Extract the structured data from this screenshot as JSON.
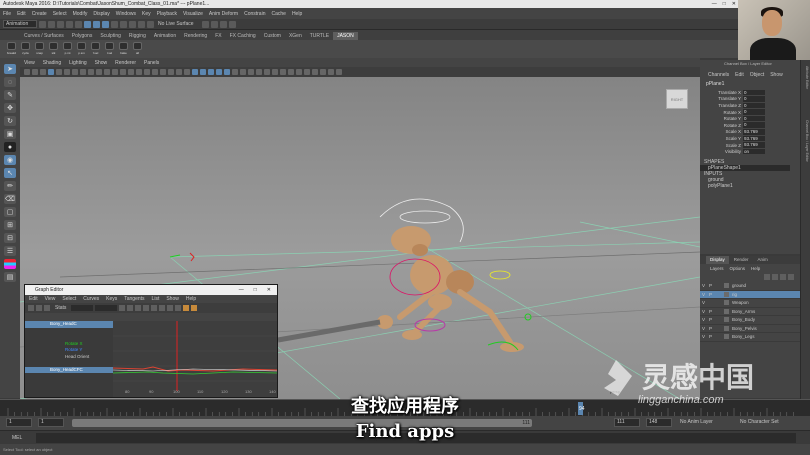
{
  "window": {
    "title": "Autodesk Maya 2016: D:\\Tutorials\\Combat\\JasonShum_Combat_Class_01.ma*   ---   pPlane1..."
  },
  "menubar": [
    "File",
    "Edit",
    "Create",
    "Select",
    "Modify",
    "Display",
    "Windows",
    "Key",
    "Playback",
    "Visualize",
    "Anim Deform",
    "Constrain",
    "Cache",
    "Help"
  ],
  "statusline": {
    "mode": "Animation",
    "surface": "No Live Surface"
  },
  "shelf": {
    "tabs": [
      "Curves / Surfaces",
      "Polygons",
      "Sculpting",
      "Rigging",
      "Animation",
      "Rendering",
      "FX",
      "FX Caching",
      "Custom",
      "XGen",
      "TURTLE",
      "JASON"
    ],
    "active_tab": "JASON",
    "buttons": [
      "breakd",
      "cycle",
      "snap",
      "stk",
      "p.mt",
      "p.sm",
      "f.sel",
      "l.sel",
      "bake",
      "all"
    ]
  },
  "viewport": {
    "menu": [
      "View",
      "Shading",
      "Lighting",
      "Show",
      "Renderer",
      "Panels"
    ],
    "viewcube_label": "RIGHT",
    "gizmo_label": "persp"
  },
  "channel_box": {
    "header": "Channel Box / Layer Editor",
    "menu": [
      "Channels",
      "Edit",
      "Object",
      "Show"
    ],
    "object": "pPlane1",
    "attributes": [
      {
        "name": "Translate X",
        "value": "0"
      },
      {
        "name": "Translate Y",
        "value": "0"
      },
      {
        "name": "Translate Z",
        "value": "0"
      },
      {
        "name": "Rotate X",
        "value": "0"
      },
      {
        "name": "Rotate Y",
        "value": "0"
      },
      {
        "name": "Rotate Z",
        "value": "0"
      },
      {
        "name": "Scale X",
        "value": "93.769"
      },
      {
        "name": "Scale Y",
        "value": "93.769"
      },
      {
        "name": "Scale Z",
        "value": "93.769"
      },
      {
        "name": "Visibility",
        "value": "on"
      }
    ],
    "shapes_label": "SHAPES",
    "shape": "pPlaneShape1",
    "inputs_label": "INPUTS",
    "inputs": [
      "ground",
      "polyPlane1"
    ]
  },
  "right_strip": {
    "tabs": [
      "Attribute Editor",
      "Channel Box / Layer Editor"
    ]
  },
  "layer_editor": {
    "tabs": [
      "Display",
      "Render",
      "Anim"
    ],
    "active_tab": "Display",
    "menu": [
      "Layers",
      "Options",
      "Help"
    ],
    "layers": [
      {
        "v": "V",
        "p": "P",
        "name": "ground",
        "selected": false
      },
      {
        "v": "V",
        "p": "P",
        "name": "rig",
        "selected": true
      },
      {
        "v": "V",
        "p": "",
        "name": "Weapon",
        "selected": false
      },
      {
        "v": "V",
        "p": "P",
        "name": "Bony_Arms",
        "selected": false
      },
      {
        "v": "V",
        "p": "P",
        "name": "Bony_Body",
        "selected": false
      },
      {
        "v": "V",
        "p": "P",
        "name": "Bony_Pelvis",
        "selected": false
      },
      {
        "v": "V",
        "p": "P",
        "name": "Bony_Legs",
        "selected": false
      }
    ]
  },
  "graph_editor": {
    "title": "Graph Editor",
    "menu": [
      "Edit",
      "View",
      "Select",
      "Curves",
      "Keys",
      "Tangents",
      "List",
      "Show",
      "Help"
    ],
    "stats_label": "Stats",
    "outliner": [
      {
        "label": "Bony_HeadC",
        "kind": "selected"
      },
      {
        "label": "",
        "kind": "plain"
      },
      {
        "label": "",
        "kind": "plain"
      },
      {
        "label": "Rotate X",
        "kind": "green"
      },
      {
        "label": "Rotate Y",
        "kind": "blue"
      },
      {
        "label": "Head Orient",
        "kind": "white"
      },
      {
        "label": "",
        "kind": "plain"
      },
      {
        "label": "Bony_HeadCFC",
        "kind": "selected"
      }
    ],
    "x_ticks": [
      "80",
      "90",
      "100",
      "110",
      "120",
      "130",
      "140"
    ]
  },
  "timeline": {
    "current_frame": "94",
    "range_start": "1",
    "range_start_inner": "1",
    "range_end_inner": "111",
    "range_end": "111",
    "range_end_outer": "148",
    "anim_layer": "No Anim Layer",
    "character_set": "No Character Set"
  },
  "command_line": {
    "label": "MEL"
  },
  "help_line": "Select Tool: select an object",
  "subtitles": {
    "zh": "查找应用程序",
    "en": "Find apps"
  },
  "watermark": {
    "name": "灵感中国",
    "url": "lingganchina.com"
  }
}
